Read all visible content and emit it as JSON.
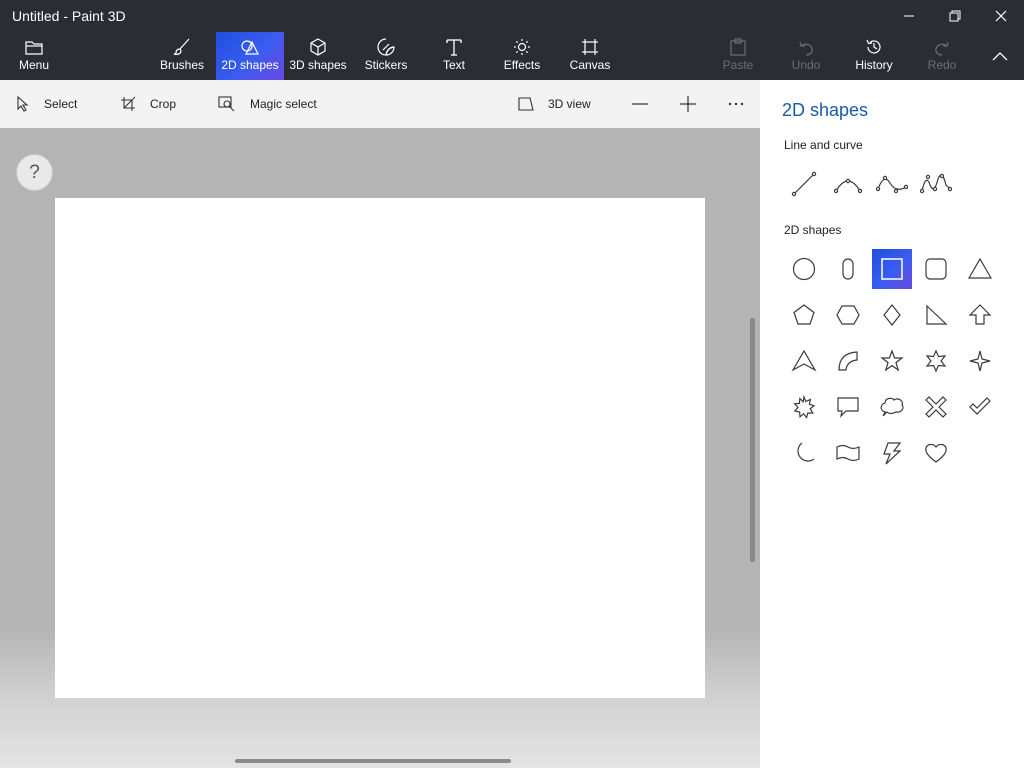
{
  "window": {
    "title": "Untitled - Paint 3D"
  },
  "ribbon": {
    "menu": {
      "label": "Menu",
      "icon": "folder-icon"
    },
    "tabs": [
      {
        "label": "Brushes",
        "icon": "brush-icon"
      },
      {
        "label": "2D shapes",
        "icon": "2d-shapes-icon",
        "active": true
      },
      {
        "label": "3D shapes",
        "icon": "cube-icon"
      },
      {
        "label": "Stickers",
        "icon": "sticker-icon"
      },
      {
        "label": "Text",
        "icon": "text-icon"
      },
      {
        "label": "Effects",
        "icon": "sun-icon"
      },
      {
        "label": "Canvas",
        "icon": "canvas-icon"
      }
    ],
    "actions": [
      {
        "label": "Paste",
        "icon": "paste-icon",
        "disabled": true
      },
      {
        "label": "Undo",
        "icon": "undo-icon",
        "disabled": true
      },
      {
        "label": "History",
        "icon": "history-icon",
        "disabled": false
      },
      {
        "label": "Redo",
        "icon": "redo-icon",
        "disabled": true
      }
    ]
  },
  "toolbar": {
    "select": "Select",
    "crop": "Crop",
    "magic_select": "Magic select",
    "view_3d": "3D view"
  },
  "canvas": {
    "help": "?"
  },
  "panel": {
    "title": "2D shapes",
    "line_section": "Line and curve",
    "shapes_section": "2D shapes",
    "line_tools": [
      "line",
      "curve-3-point",
      "curve-4-point",
      "curve-5-point"
    ],
    "shapes": [
      "circle",
      "pill",
      "square",
      "rounded-square",
      "triangle",
      "pentagon",
      "hexagon",
      "diamond",
      "right-triangle",
      "arrow-up",
      "arrowhead",
      "quarter-circle",
      "star-5",
      "star-6",
      "star-4",
      "burst",
      "speech-bubble",
      "thought-bubble",
      "cross",
      "checkmark",
      "crescent",
      "banner",
      "lightning",
      "heart"
    ],
    "selected_shape": "square"
  },
  "colors": {
    "chrome": "#2b2d34",
    "accent": "#3b5cf0",
    "panel_title": "#1a5aa8",
    "workspace": "#b4b4b4"
  }
}
